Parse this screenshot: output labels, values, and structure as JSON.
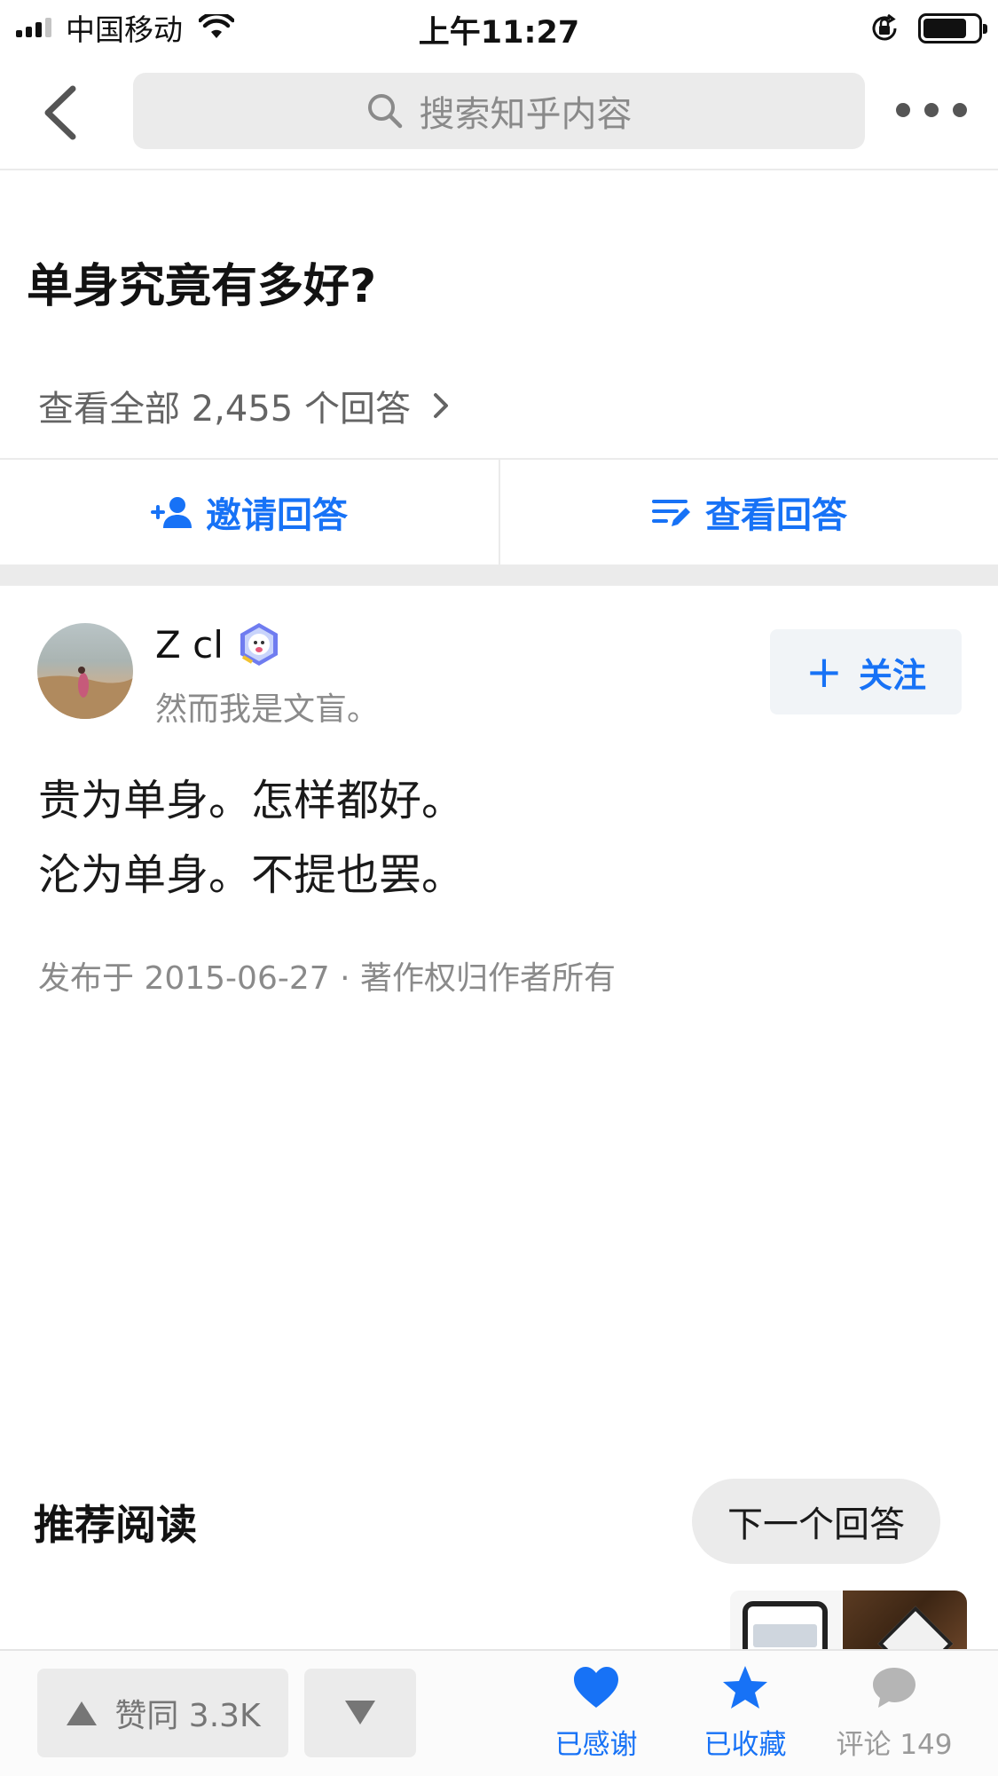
{
  "status_bar": {
    "carrier": "中国移动",
    "time": "上午11:27",
    "signal_bars_filled": 3,
    "signal_bars_total": 4,
    "battery_level": 0.8
  },
  "nav": {
    "back_icon": "chevron-left-icon",
    "search_placeholder": "搜索知乎内容",
    "more_icon": "more-dots-icon"
  },
  "question": {
    "title": "单身究竟有多好?",
    "view_all_label": "查看全部 2,455 个回答"
  },
  "actions": {
    "invite_label": "邀请回答",
    "view_label": "查看回答"
  },
  "answer": {
    "author_name": "Z cl",
    "author_bio": "然而我是文盲。",
    "follow_label": "关注",
    "content_lines": [
      "贵为单身。怎样都好。",
      "沦为单身。不提也罢。"
    ],
    "meta": "发布于 2015-06-27 · 著作权归作者所有"
  },
  "recommend": {
    "title": "推荐阅读",
    "next_answer_label": "下一个回答"
  },
  "bottom_bar": {
    "vote_up_label": "赞同 3.3K",
    "thanks_label": "已感谢",
    "collect_label": "已收藏",
    "comment_label": "评论 149"
  },
  "colors": {
    "accent": "#1772f6",
    "divider": "#ebebeb",
    "muted_text": "#8a8a8a"
  }
}
